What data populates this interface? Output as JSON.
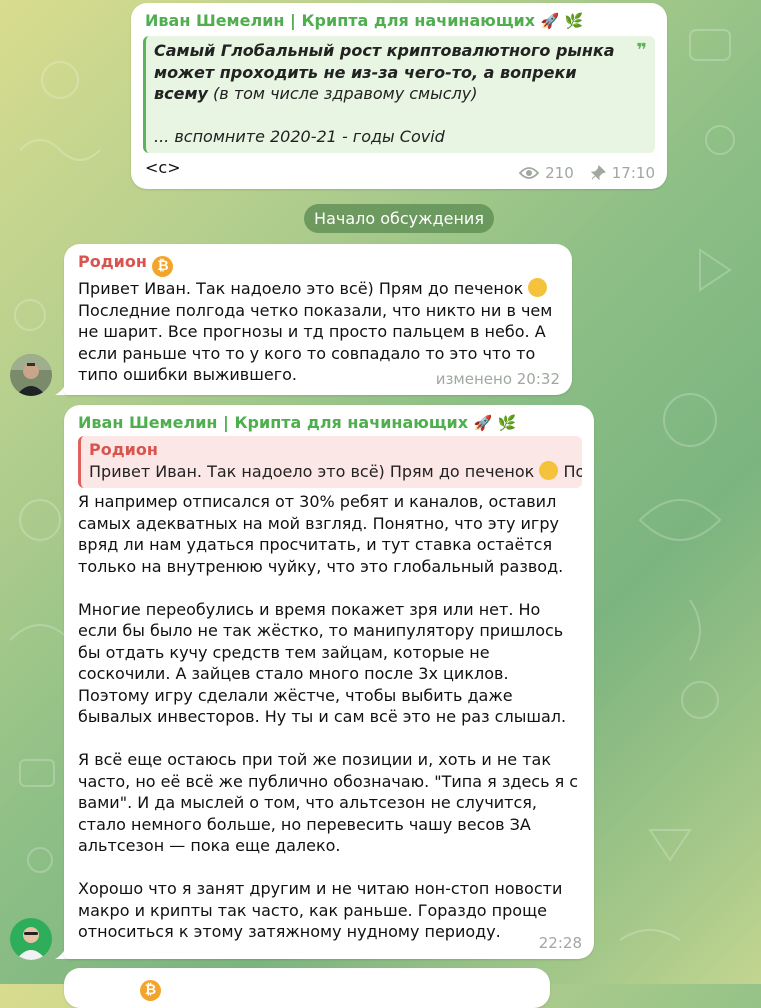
{
  "channel_post": {
    "sender": "Иван Шемелин | Крипта для начинающих",
    "sender_emoji": [
      "rocket-emoji",
      "plant-emoji"
    ],
    "quote_bold": "Самый Глобальный рост криптовалютного рынка может проходить не из-за чего-то, а вопреки всему",
    "quote_normal": " (в том числе здравому смыслу)",
    "quote_line2": "... вспомните 2020-21 - годы Covid",
    "quote_mark": "❞",
    "signature": "<c>",
    "views": "210",
    "time": "17:10"
  },
  "discussion_label": "Начало обсуждения",
  "messages": [
    {
      "sender": "Родион",
      "text": "Привет Иван. Так надоело это всё) Прям до печенок 😂\nПоследние полгода четко показали, что никто ни в чем не шарит. Все прогнозы и тд просто пальцем в небо. А если раньше что то у кого то совпадало то это что то типо ошибки выжившего.",
      "line1": "Привет Иван. Так надоело это всё) Прям до печенок",
      "rest": "Последние полгода четко показали, что никто ни в чем не шарит. Все прогнозы и тд просто пальцем в небо. А если раньше что то у кого то совпадало то это что то типо ошибки выжившего.",
      "time": "изменено 20:32"
    },
    {
      "sender": "Иван Шемелин | Крипта для начинающих",
      "reply_name": "Родион",
      "reply_text": "Привет Иван. Так надоело это всё) Прям до печенок",
      "reply_suffix": " По...",
      "p1": "Я например отписался от 30% ребят и каналов, оставил самых адекватных на мой взгляд. Понятно, что эту игру вряд ли нам удаться просчитать, и тут ставка остаётся только на внутренюю чуйку, что это глобальный развод.",
      "p2": "Многие переобулись и время покажет зря или нет. Но если бы было не так жёстко, то манипулятору пришлось бы отдать кучу средств тем зайцам, которые не соскочили. А зайцев стало много после 3х циклов. Поэтому игру сделали жёстче, чтобы выбить даже бывалых инвесторов. Ну ты и сам всё это не раз слышал.",
      "p3": "Я всё еще остаюсь при той же позиции и, хоть и не так часто, но её всё же публично обозначаю. \"Типа я здесь я с вами\". И да мыслей о том, что альтсезон не случится, стало немного больше, но перевесить чашу весов ЗА альтсезон — пока еще далеко.",
      "p4": "Хорошо что я занят другим и не читаю нон-стоп новости макро и крипты так часто, как раньше. Гораздо проще относиться к этому затяжному нудному периоду.",
      "time": "22:28"
    }
  ],
  "colors": {
    "channel_name": "#4fae4e",
    "rodion_name": "#d9534f",
    "meta": "#a0a8a0",
    "bitcoin": "#f2a52d"
  }
}
